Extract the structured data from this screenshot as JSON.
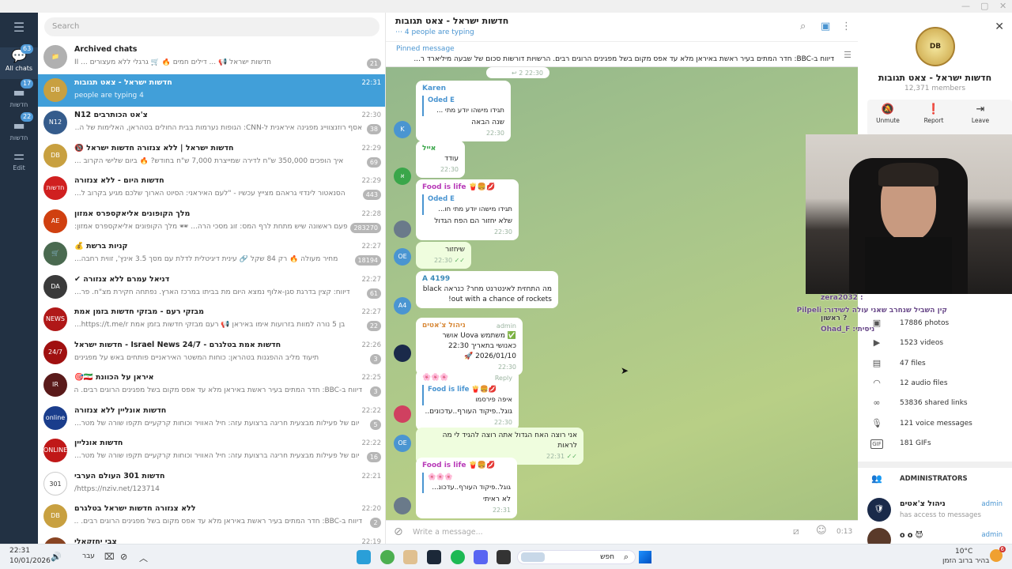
{
  "window": {
    "min": "—",
    "max": "▢",
    "close": "✕"
  },
  "rail": {
    "items": [
      {
        "label": "All chats",
        "badge": "63",
        "icon": "chat-bubbles-icon"
      },
      {
        "label": "חדשות",
        "badge": "17",
        "icon": "folder-icon"
      },
      {
        "label": "חדשות",
        "badge": "22",
        "icon": "folder-icon"
      },
      {
        "label": "Edit",
        "badge": "",
        "icon": "sliders-icon"
      }
    ]
  },
  "search": {
    "placeholder": "Search"
  },
  "chats": [
    {
      "title": "Archived chats",
      "msg": "חדשות ישראל 📢 ... דילים חמים 🔥 🛒 גרגלי ללא מעצורים ... II",
      "time": "",
      "badge": "21",
      "avatar_color": "#b0b0b0",
      "avatar_text": "📁"
    },
    {
      "title": "חדשות ישראל - צאט תגובות",
      "msg": "4 people are typing",
      "time": "22:31",
      "badge": "",
      "avatar_color": "#c8a040",
      "avatar_text": "DB",
      "selected": true
    },
    {
      "title": "צ'אט הכותרבים N12",
      "msg": "אסף רוזנצווייג מפגינה איראנית ל-CNN: הגופות נערמות בבית החולים בטהראן, האלימות של ה...",
      "time": "22:30",
      "badge": "38",
      "avatar_color": "#355c8c",
      "avatar_text": "N12"
    },
    {
      "title": "חדשות ישראל | ללא צנזורה חדשות ישראל 🔞",
      "msg": "איך הופכים 350,000 ש\"ח לדירה שמייצרת 7,000 ש\"ח בחודש? 🔥 ביום שלישי הקרוב ...",
      "time": "22:29",
      "badge": "69",
      "avatar_color": "#c8a040",
      "avatar_text": "DB"
    },
    {
      "title": "חדשות היום - ללא צנזורה",
      "msg": "הסנאטור לינדזי גראהם מצייץ עכשיו - \"לעם האיראני: הסיוט הארוך שלכם מגיע בקרוב ל...",
      "time": "22:29",
      "badge": "443",
      "avatar_color": "#d02020",
      "avatar_text": "חדשות"
    },
    {
      "title": "מלך הקופונים אליאקספרס אמזון",
      "msg": "פעם ראשונה שיש מתחת לרף המס: זוג מסכי הרה... 🕶 מלך הקופונים אליאקספרס אמזון:",
      "time": "22:28",
      "badge": "283270",
      "avatar_color": "#d04010",
      "avatar_text": "AE"
    },
    {
      "title": "קניות ברשת 💰",
      "msg": "מחיר מעולה 🔥 רק 84 שקל 🔗 עינית דיגיטלית לדלת עם מסך 3.5 אינץ', זווית רחבה...",
      "time": "22:27",
      "badge": "18194",
      "avatar_color": "#4a6a50",
      "avatar_text": "🛒"
    },
    {
      "title": "דניאל עמרם ללא צנזורה ✔",
      "msg": "דיווח: קצין בדרגת סגן-אלוף נמצא היום מת בביתו במרכז הארץ. נפתחה חקירת מצ\"ח. פר...",
      "time": "22:27",
      "badge": "61",
      "avatar_color": "#3a3a3a",
      "avatar_text": "DA"
    },
    {
      "title": "מבזקי רעם - מבזקי חדשות בזמן אמת",
      "msg": "בן 5 נורה למוות בזרועות אימו באיראן 📢 רעם מבזקי חדשות בזמן אמת https://t.me/r...",
      "time": "22:27",
      "badge": "22",
      "avatar_color": "#b01818",
      "avatar_text": "NEWS"
    },
    {
      "title": "חדשות אמת בטלגרם - Israel News 24/7 - חדשות ישראל",
      "msg": "תיעוד מליב ההפגנות בטהראן: כוחות המשטר האיראניים פותחים באש על מפגינים",
      "time": "22:26",
      "badge": "3",
      "avatar_color": "#a01010",
      "avatar_text": "24/7"
    },
    {
      "title": "איראן על הכוונת 🇮🇷🎯",
      "msg": "דיווח ב-BBC: חדר המתים בעיר ראשת באיראן מלא עד אפס מקום בשל מפגינים הרוגים רבים. הר...",
      "time": "22:25",
      "badge": "3",
      "avatar_color": "#5a1a1a",
      "avatar_text": "IR"
    },
    {
      "title": "חדשות אונליין ללא צנזורה",
      "msg": "יום של פעילות מבצעית חריגה ברצועת עזה: חיל האוויר וכוחות קרקעיים תקפו שורה של מטר...",
      "time": "22:22",
      "badge": "5",
      "avatar_color": "#1a3d8c",
      "avatar_text": "online"
    },
    {
      "title": "חדשות אונליין",
      "msg": "יום של פעילות מבצעית חריגה ברצועת עזה: חיל האוויר וכוחות קרקעיים תקפו שורה של מטר...",
      "time": "22:22",
      "badge": "16",
      "avatar_color": "#c01818",
      "avatar_text": "ONLINE"
    },
    {
      "title": "חדשות 301 העולם הערבי",
      "msg": "https://nziv.net/123714/",
      "time": "22:21",
      "badge": "",
      "avatar_color": "#ffffff",
      "avatar_text": "301"
    },
    {
      "title": "ללא צנזורה חדשות ישראל בטלגרם",
      "msg": "דיווח ב-BBC: חדר המתים בעיר ראשת באיראן מלא עד אפס מקום בשל מפגינים הרוגים רבים. ...",
      "time": "22:20",
      "badge": "2",
      "avatar_color": "#c8a040",
      "avatar_text": "DB"
    },
    {
      "title": "צבי יחזקאלי",
      "msg": "",
      "time": "22:19",
      "badge": "",
      "avatar_color": "#884422",
      "avatar_text": "צי"
    }
  ],
  "chat": {
    "title": "חדשות ישראל - צאט תגובות",
    "status": "4 people are typing",
    "pinned_label": "Pinned message",
    "pinned_text": "דיווח ב-BBC: חדר המתים בעיר ראשת באיראן מלא עד אפס מקום בשל מפגינים הרוגים רבים. הרשויות דורשות סכום של שבעה מיליארד ר...",
    "composer_placeholder": "Write a message...",
    "composer_time": "0:13",
    "top_fragment": {
      "reply": "↩ 2",
      "time": "22:30"
    },
    "messages": [
      {
        "sender": "Karen",
        "sender_color": "#4a95d1",
        "quote_name": "Oded E",
        "quote_text": "תגידו מישהו יודע מתי ...",
        "text": "שנה הבאה",
        "time": "22:30",
        "avatar": "K",
        "avatar_color": "#4a95d1"
      },
      {
        "sender": "אייל",
        "sender_color": "#3aa64a",
        "quote_name": "",
        "quote_text": "",
        "text": "עודד",
        "time": "22:30",
        "avatar": "א",
        "avatar_color": "#3aa64a"
      },
      {
        "sender": "Food is life 🍟🍔💋",
        "sender_color": "#b83ab8",
        "quote_name": "Oded E",
        "quote_text": "תגידו מישהו יודע מתי חו...",
        "text": "שלא יחזור הם הפח הגדול",
        "time": "22:30",
        "avatar": "",
        "avatar_color": "#6a7a8a"
      },
      {
        "sender": "",
        "sender_color": "",
        "quote_name": "",
        "quote_text": "",
        "text": "שיחזור",
        "time": "22:30",
        "avatar": "OE",
        "avatar_color": "#4a95d1",
        "out": true
      },
      {
        "sender": "A 4199",
        "sender_color": "#3a8ab8",
        "quote_name": "",
        "quote_text": "",
        "text": "מה התחזית לאינטרנט מחר? כנראה black out with a chance of rockets!",
        "time": "",
        "avatar": "A4",
        "avatar_color": "#4a95d1"
      },
      {
        "sender": "ניהול צ'אטים",
        "sender_color": "#d88a3a",
        "tag": "admin",
        "quote_name": "",
        "quote_text": "",
        "text": "✅ משתמש Uova אושר כאנושי בתאריך 22:30 2026/01/10 🚀",
        "time": "22:30",
        "avatar": "",
        "avatar_color": "#1a2a4a"
      },
      {
        "sender": "🌸🌸🌸",
        "sender_color": "#d04080",
        "tag": "Reply",
        "quote_name": "Food is life 🍟🍔💋",
        "quote_text": "איפה פירסמו",
        "text": "גוגל..פיקוד העורף..עדכונים..",
        "time": "22:30",
        "avatar": "",
        "avatar_color": "#d04060"
      },
      {
        "sender": "",
        "sender_color": "",
        "quote_name": "",
        "quote_text": "",
        "text": "אני רוצה האח הגדול אתה רוצה להגיד לי מה לראות",
        "time": "22:31",
        "avatar": "OE",
        "avatar_color": "#4a95d1",
        "out": true
      },
      {
        "sender": "Food is life 🍟🍔💋",
        "sender_color": "#b83ab8",
        "quote_name": "🌸🌸🌸",
        "quote_text": "גוגל..פיקוד העורף..עדכונ...",
        "text": "לא ראיתי",
        "time": "22:31",
        "avatar": "",
        "avatar_color": "#6a7a8a"
      }
    ]
  },
  "info": {
    "name": "חדשות ישראל - צאט תגובות",
    "members": "12,371 members",
    "actions": [
      {
        "label": "Unmute",
        "icon": "bell-off-icon"
      },
      {
        "label": "Report",
        "icon": "report-icon"
      },
      {
        "label": "Leave",
        "icon": "leave-icon"
      }
    ],
    "media": [
      {
        "label": "17886 photos",
        "icon": "photo-icon"
      },
      {
        "label": "1523 videos",
        "icon": "video-icon"
      },
      {
        "label": "47 files",
        "icon": "file-icon"
      },
      {
        "label": "12 audio files",
        "icon": "headphones-icon"
      },
      {
        "label": "53836 shared links",
        "icon": "link-icon"
      },
      {
        "label": "121 voice messages",
        "icon": "mic-icon"
      },
      {
        "label": "181 GIFs",
        "icon": "gif-icon"
      }
    ],
    "admins_title": "ADMINISTRATORS",
    "admins": [
      {
        "name": "ניהול צ'אטים",
        "sub": "has access to messages",
        "role": "admin"
      },
      {
        "name": "o o 😈",
        "sub": "",
        "role": "admin"
      }
    ]
  },
  "overlay": {
    "lines": [
      "zera2032 :",
      "קין השביל שנחרב שאני עולה לשידור: Pilpeli",
      "? ראשון",
      "Ohad_F :ניסיתי"
    ]
  },
  "taskbar": {
    "time": "22:31",
    "date": "10/01/2026",
    "lang": "עבר",
    "search": "חפש",
    "weather_temp": "10°C",
    "weather_text": "בהיר ברוב הזמן",
    "notif": "6"
  }
}
